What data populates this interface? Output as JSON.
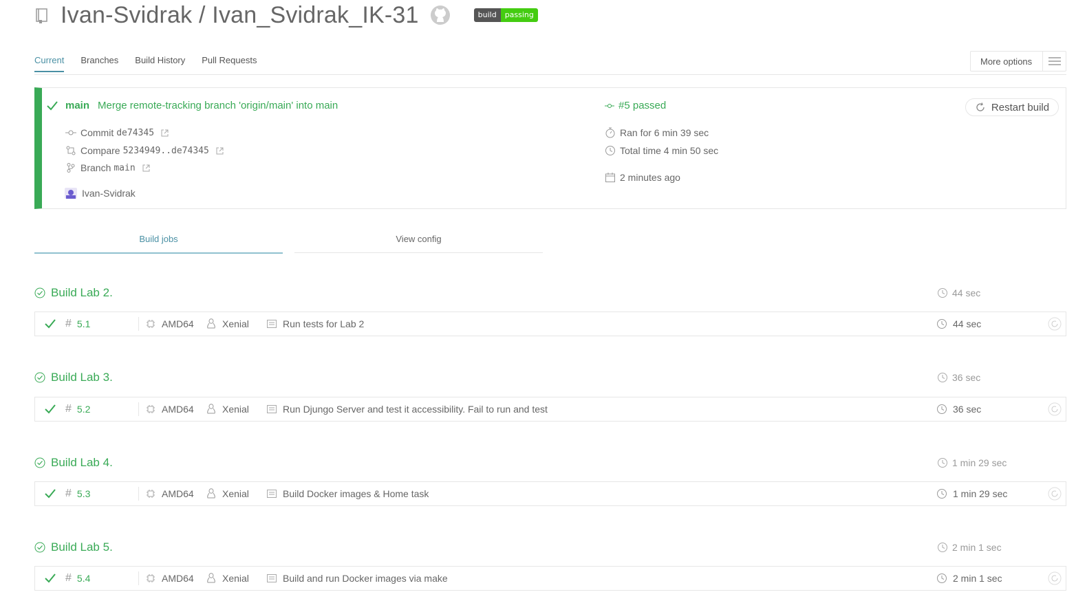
{
  "header": {
    "repo_title": "Ivan-Svidrak / Ivan_Svidrak_IK-31",
    "badge_left": "build",
    "badge_right": "passing"
  },
  "tabs": [
    "Current",
    "Branches",
    "Build History",
    "Pull Requests"
  ],
  "active_tab": "Current",
  "more_options_label": "More options",
  "build": {
    "branch": "main",
    "message": "Merge remote-tracking branch 'origin/main' into main",
    "number_status": "#5 passed",
    "commit_label": "Commit",
    "commit_hash": "de74345",
    "compare_label": "Compare",
    "compare_range": "5234949..de74345",
    "branch_label": "Branch",
    "branch_value": "main",
    "author": "Ivan-Svidrak",
    "ran_for": "Ran for 6 min 39 sec",
    "total_time": "Total time 4 min 50 sec",
    "finished": "2 minutes ago",
    "restart_label": "Restart build"
  },
  "job_tabs": [
    "Build jobs",
    "View config"
  ],
  "stages": [
    {
      "title": "Build Lab 2.",
      "time": "44 sec",
      "job": {
        "number": "5.1",
        "arch": "AMD64",
        "os": "Xenial",
        "name": "Run tests for Lab 2",
        "time": "44 sec"
      }
    },
    {
      "title": "Build Lab 3.",
      "time": "36 sec",
      "job": {
        "number": "5.2",
        "arch": "AMD64",
        "os": "Xenial",
        "name": "Run Djungo Server and test it accessibility. Fail to run and test",
        "time": "36 sec"
      }
    },
    {
      "title": "Build Lab 4.",
      "time": "1 min 29 sec",
      "job": {
        "number": "5.3",
        "arch": "AMD64",
        "os": "Xenial",
        "name": "Build Docker images & Home task",
        "time": "1 min 29 sec"
      }
    },
    {
      "title": "Build Lab 5.",
      "time": "2 min 1 sec",
      "job": {
        "number": "5.4",
        "arch": "AMD64",
        "os": "Xenial",
        "name": "Build and run Docker images via make",
        "time": "2 min 1 sec"
      }
    }
  ],
  "colors": {
    "passed": "#39aa56",
    "link": "#4a90a4",
    "border": "#e6e6e6"
  }
}
